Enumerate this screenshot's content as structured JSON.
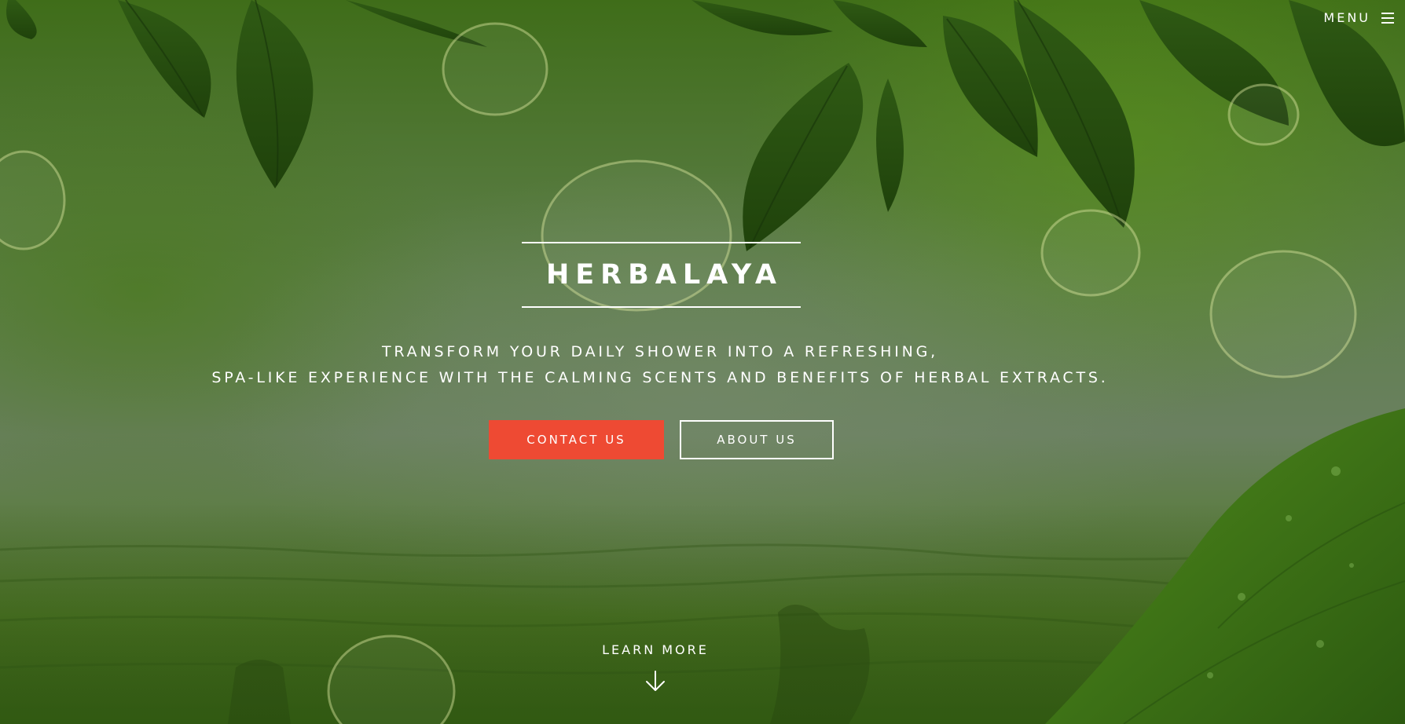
{
  "header": {
    "menu_label": "MENU",
    "menu_icon": "hamburger-icon"
  },
  "hero": {
    "title": "HERBALAYA",
    "tagline_line1": "TRANSFORM YOUR DAILY SHOWER INTO A REFRESHING,",
    "tagline_line2": "SPA-LIKE EXPERIENCE WITH THE CALMING SCENTS AND BENEFITS OF HERBAL EXTRACTS.",
    "buttons": {
      "contact_label": "CONTACT US",
      "about_label": "ABOUT US"
    },
    "learn_more_label": "LEARN MORE",
    "learn_more_icon": "arrow-down-icon"
  },
  "colors": {
    "accent": "#ee4a33",
    "text": "#ffffff",
    "background_green": "#5f7f4c"
  }
}
